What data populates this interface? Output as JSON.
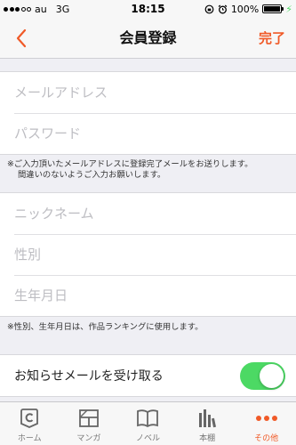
{
  "status_bar": {
    "carrier": "au",
    "network": "3G",
    "time": "18:15",
    "battery": "100%"
  },
  "nav": {
    "title": "会員登録",
    "done_label": "完了",
    "accent_color": "#f05a28"
  },
  "account_group": {
    "email_placeholder": "メールアドレス",
    "password_placeholder": "パスワード",
    "note_line1": "※ご入力頂いたメールアドレスに登録完了メールをお送りします。",
    "note_line2": "間違いのないようご入力お願いします。"
  },
  "profile_group": {
    "nickname_placeholder": "ニックネーム",
    "gender_placeholder": "性別",
    "birthday_placeholder": "生年月日",
    "note": "※性別、生年月日は、作品ランキングに使用します。"
  },
  "newsletter": {
    "label": "お知らせメールを受け取る",
    "enabled": true,
    "switch_color": "#4cd964"
  },
  "tabs": [
    {
      "label": "ホーム",
      "icon": "home-c-icon",
      "active": false
    },
    {
      "label": "マンガ",
      "icon": "manga-icon",
      "active": false
    },
    {
      "label": "ノベル",
      "icon": "book-icon",
      "active": false
    },
    {
      "label": "本棚",
      "icon": "bookshelf-icon",
      "active": false
    },
    {
      "label": "その他",
      "icon": "more-icon",
      "active": true
    }
  ]
}
